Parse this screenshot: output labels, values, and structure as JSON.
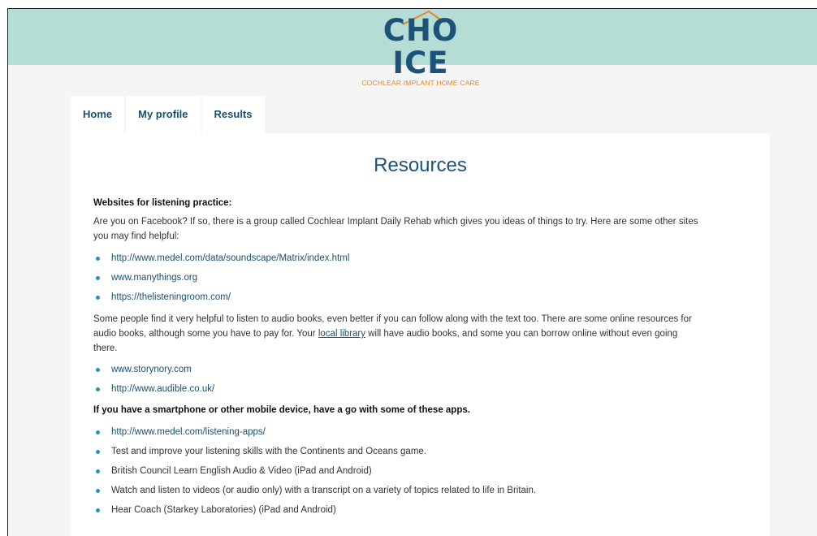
{
  "logo": {
    "word_left": "CH",
    "word_o": "O",
    "word_right": "ICE",
    "subtitle": "COCHLEAR IMPLANT HOME CARE"
  },
  "tabs": [
    {
      "label": "Home"
    },
    {
      "label": "My profile"
    },
    {
      "label": "Results"
    }
  ],
  "page": {
    "title": "Resources"
  },
  "section1": {
    "heading": "Websites for listening practice:",
    "intro_line1": "Are you on Facebook? If so, there is a group called Cochlear Implant Daily Rehab which gives you ideas of things to try. Here are some other sites",
    "intro_line2": "you may find helpful:",
    "links": [
      "http://www.medel.com/data/soundscape/Matrix/index.html",
      "www.manythings.org",
      "https://thelisteningroom.com/"
    ],
    "audio_line1": "Some people find it very helpful to listen to audio books, even better if you can follow along with the text too. There are some online resources for",
    "audio_line2_before": "audio books, although some you have to pay for. Your ",
    "audio_line2_link": "local library",
    "audio_line2_after": " will have audio books, and some you can borrow online without even going",
    "audio_line3": "there.",
    "audio_links": [
      "www.storynory.com",
      "http://www.audible.co.uk/"
    ]
  },
  "section2": {
    "heading": "If you have a smartphone or other mobile device, have a go with some of these apps.",
    "items": [
      "http://www.medel.com/listening-apps/",
      "Test and improve your listening skills with the Continents and Oceans game.",
      "British Council Learn English Audio & Video (iPad and Android)",
      "Watch and listen to videos (or audio only) with a transcript on a variety of topics related to life in Britain.",
      "Hear Coach (Starkey Laboratories) (iPad and Android)"
    ]
  },
  "colors": {
    "header_bg": "#b5dcd5",
    "brand_blue": "#1c5378",
    "brand_orange": "#e08a2b",
    "bullet": "#2e8fb0"
  }
}
